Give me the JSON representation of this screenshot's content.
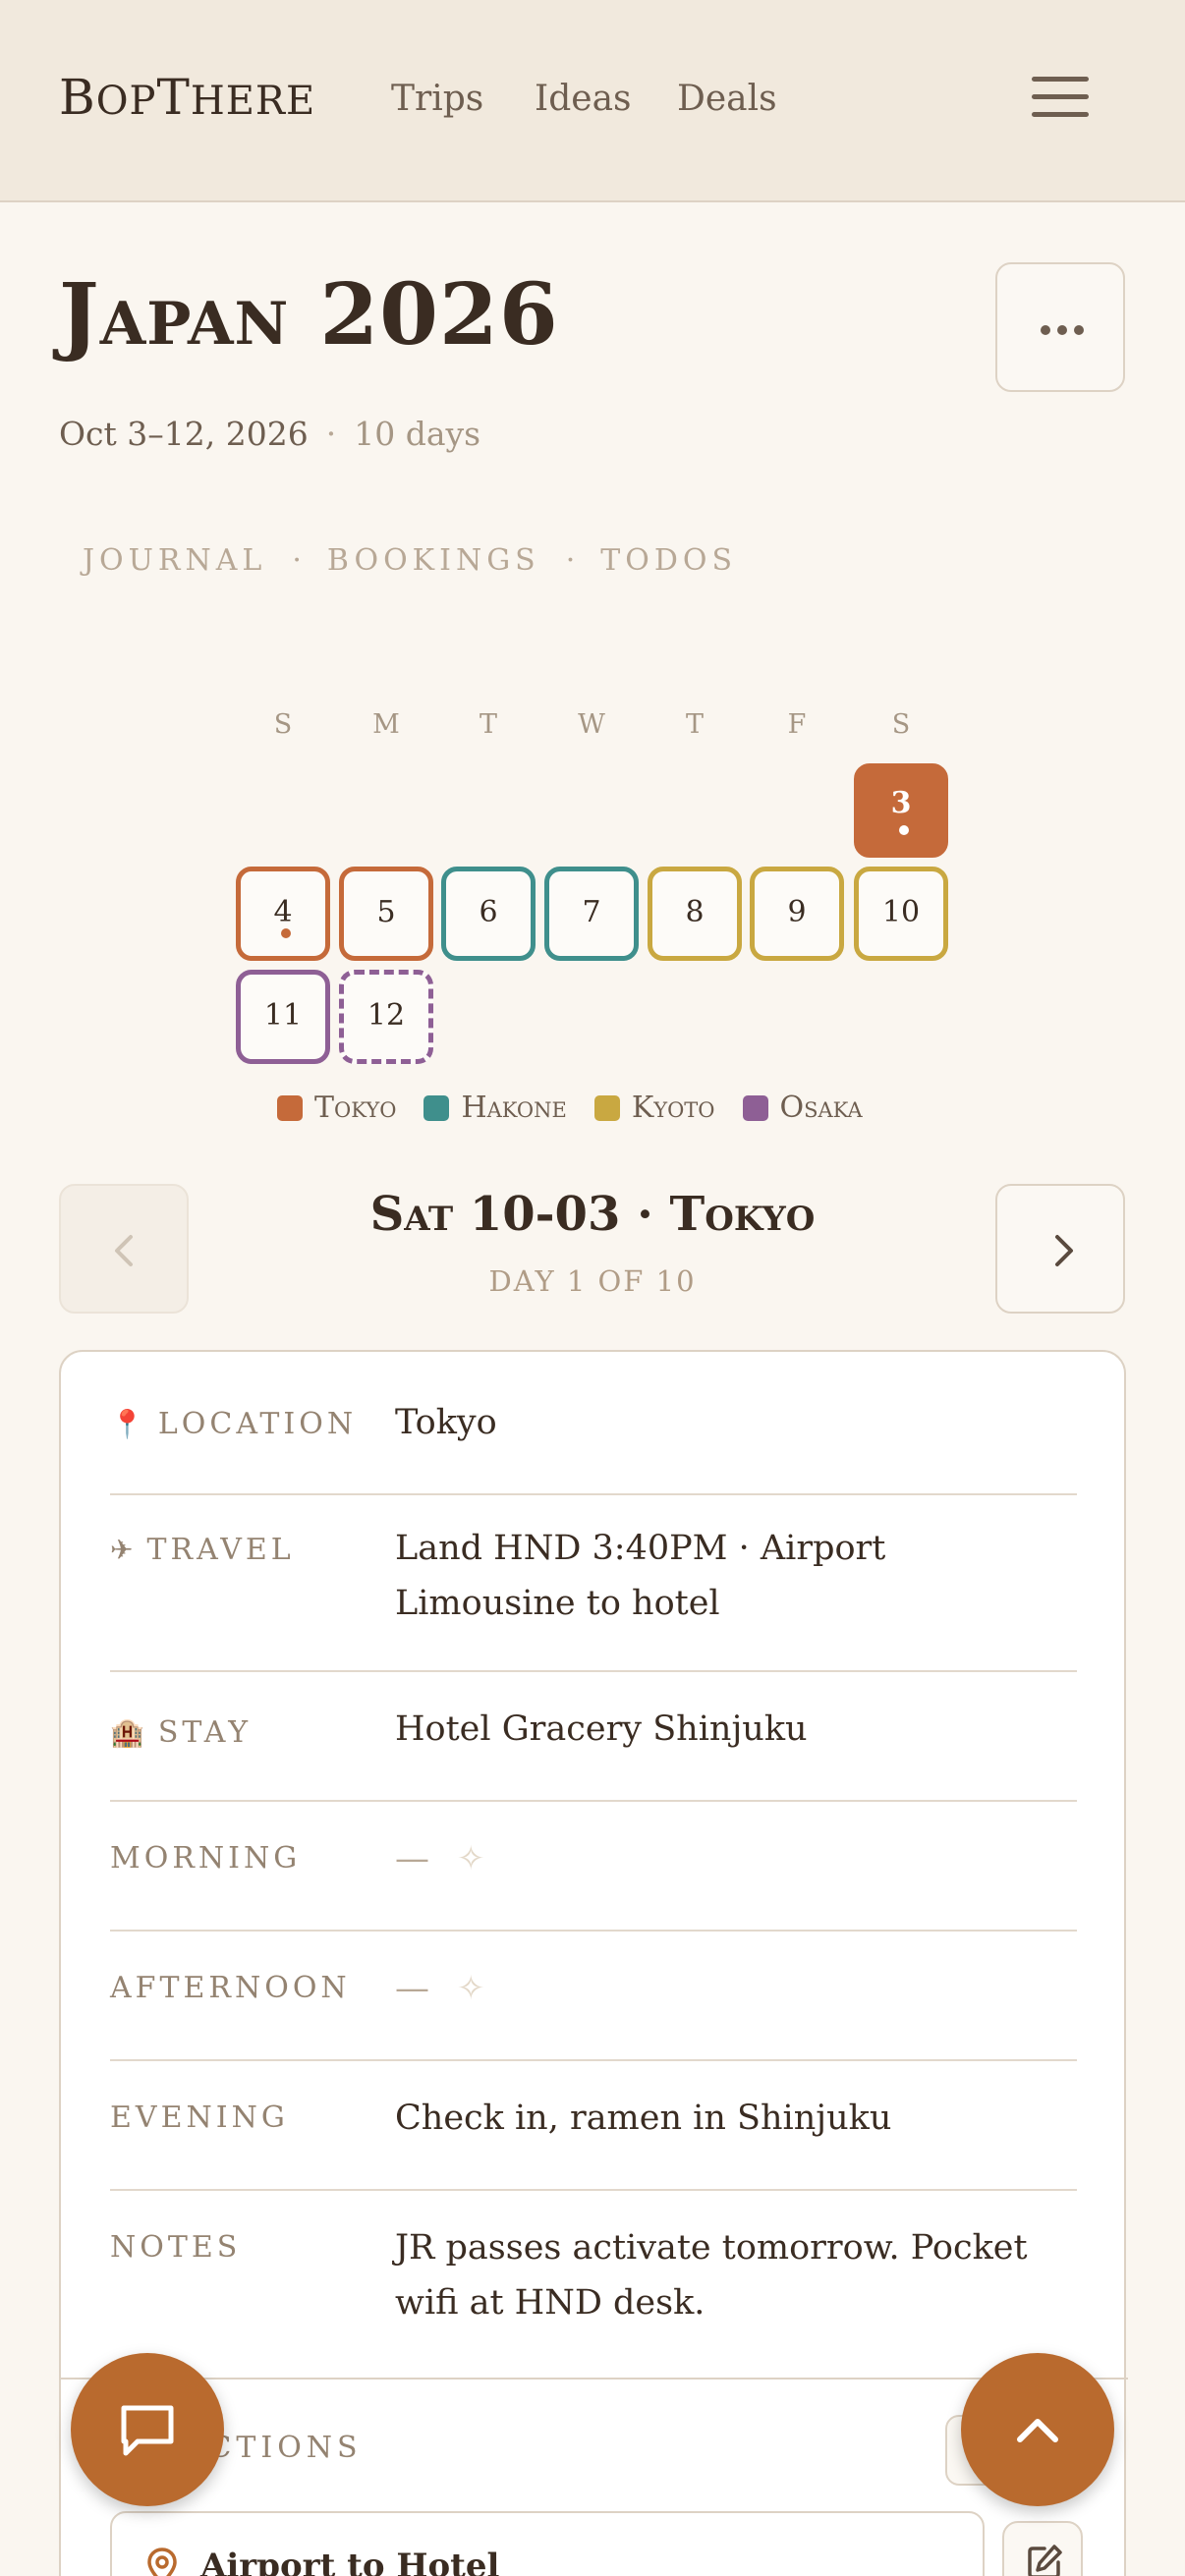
{
  "header": {
    "brand_initial_1": "B",
    "brand_part_1": "OP",
    "brand_initial_2": "T",
    "brand_part_2": "HERE",
    "nav": [
      "Trips",
      "Ideas",
      "Deals"
    ],
    "menu_icon": "hamburger-icon"
  },
  "trip": {
    "title": "Japan 2026",
    "more_icon": "ellipsis-icon",
    "date_range": "Oct 3–12, 2026",
    "separator": "·",
    "duration": "10 days"
  },
  "tabs": [
    "JOURNAL",
    "BOOKINGS",
    "TODOS"
  ],
  "tab_separator": "·",
  "calendar": {
    "weekdays": [
      "S",
      "M",
      "T",
      "W",
      "T",
      "F",
      "S"
    ],
    "days": [
      {
        "num": "3",
        "city": "Tokyo",
        "selected": true,
        "has_entry": true
      },
      {
        "num": "4",
        "city": "Tokyo",
        "has_entry": true
      },
      {
        "num": "5",
        "city": "Tokyo"
      },
      {
        "num": "6",
        "city": "Hakone"
      },
      {
        "num": "7",
        "city": "Hakone"
      },
      {
        "num": "8",
        "city": "Kyoto"
      },
      {
        "num": "9",
        "city": "Kyoto"
      },
      {
        "num": "10",
        "city": "Kyoto"
      },
      {
        "num": "11",
        "city": "Osaka"
      },
      {
        "num": "12",
        "city": "Osaka",
        "departure": true
      }
    ],
    "legend": [
      {
        "name": "Tokyo",
        "color": "#c56a3a"
      },
      {
        "name": "Hakone",
        "color": "#3f8f8c"
      },
      {
        "name": "Kyoto",
        "color": "#c9a841"
      },
      {
        "name": "Osaka",
        "color": "#8e5f95"
      }
    ]
  },
  "day_nav": {
    "title": "Sat 10-03 · Tokyo",
    "subtitle": "DAY 1 OF 10",
    "prev_icon": "chevron-left-icon",
    "next_icon": "chevron-right-icon",
    "prev_disabled": true
  },
  "day_card": {
    "rows": [
      {
        "label": "LOCATION",
        "icon": "📍",
        "icon_name": "pin-icon",
        "value": "Tokyo"
      },
      {
        "label": "TRAVEL",
        "icon": "✈",
        "icon_name": "airplane-icon",
        "value": "Land HND 3:40PM · Airport Limousine to hotel"
      },
      {
        "label": "STAY",
        "icon": "🏨",
        "icon_name": "hotel-icon",
        "value": "Hotel Gracery Shinjuku"
      },
      {
        "label": "MORNING",
        "value": "—",
        "empty": true,
        "suggest_icon": "sparkle-icon"
      },
      {
        "label": "AFTERNOON",
        "value": "—",
        "empty": true,
        "suggest_icon": "sparkle-icon"
      },
      {
        "label": "EVENING",
        "value": "Check in, ramen in Shinjuku"
      },
      {
        "label": "NOTES",
        "value": "JR passes activate tomorrow. Pocket wifi at HND desk."
      }
    ],
    "directions_label": "DIRECTIONS",
    "directions": [
      {
        "name": "Airport to Hotel",
        "icon": "map-pin-icon"
      }
    ],
    "edit_icon": "edit-icon"
  },
  "fabs": {
    "chat_icon": "chat-icon",
    "scroll_top_icon": "chevron-up-icon"
  },
  "colors": {
    "accent": "#b96a2e",
    "background": "#faf6f0",
    "header_bg": "#f1e9dd"
  }
}
